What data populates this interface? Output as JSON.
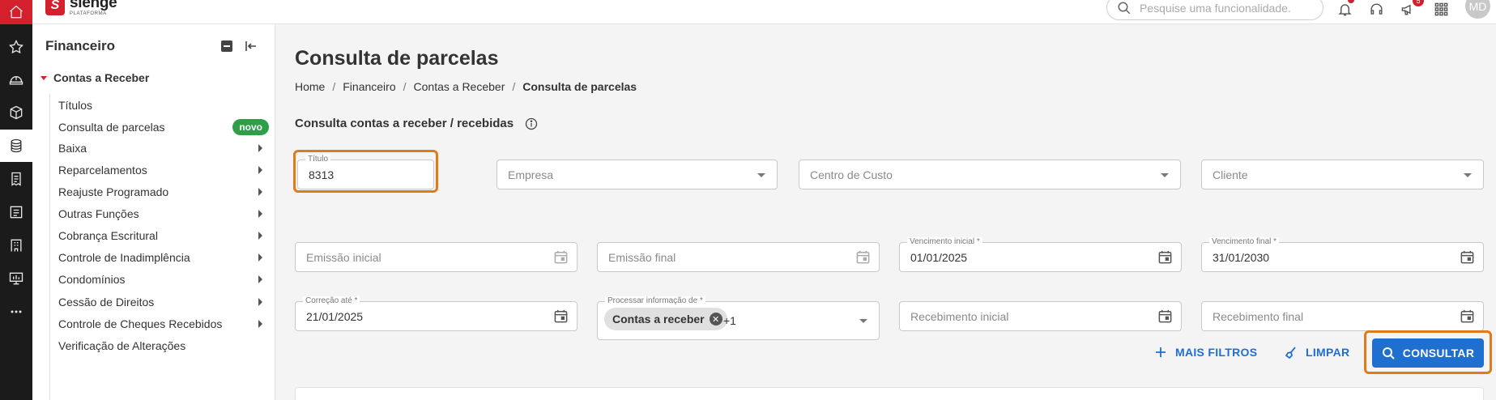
{
  "brand": {
    "name": "sienge",
    "subtitle": "PLATAFORMA",
    "mark": "S",
    "color": "#d4202c"
  },
  "topbar": {
    "search_placeholder": "Pesquise uma funcionalidade.",
    "notifications_badge": "5",
    "user_initials": "MD"
  },
  "sidebar": {
    "title": "Financeiro",
    "group": "Contas a Receber",
    "items": [
      {
        "label": "Títulos"
      },
      {
        "label": "Consulta de parcelas",
        "tag": "novo"
      },
      {
        "label": "Baixa"
      },
      {
        "label": "Reparcelamentos"
      },
      {
        "label": "Reajuste Programado"
      },
      {
        "label": "Outras Funções"
      },
      {
        "label": "Cobrança Escritural"
      },
      {
        "label": "Controle de Inadimplência"
      },
      {
        "label": "Condomínios"
      },
      {
        "label": "Cessão de Direitos"
      },
      {
        "label": "Controle de Cheques Recebidos"
      },
      {
        "label": "Verificação de Alterações"
      }
    ]
  },
  "main": {
    "title": "Consulta de parcelas",
    "breadcrumb": [
      "Home",
      "Financeiro",
      "Contas a Receber",
      "Consulta de parcelas"
    ],
    "section_title": "Consulta contas a receber / recebidas",
    "fields": {
      "titulo": {
        "label": "Título",
        "value": "8313"
      },
      "empresa": {
        "placeholder": "Empresa"
      },
      "centro_custo": {
        "placeholder": "Centro de Custo"
      },
      "cliente": {
        "placeholder": "Cliente"
      },
      "emissao_inicial": {
        "placeholder": "Emissão inicial"
      },
      "emissao_final": {
        "placeholder": "Emissão final"
      },
      "vencimento_inicial": {
        "label": "Vencimento inicial *",
        "value": "01/01/2025"
      },
      "vencimento_final": {
        "label": "Vencimento final *",
        "value": "31/01/2030"
      },
      "correcao_ate": {
        "label": "Correção até *",
        "value": "21/01/2025"
      },
      "processar": {
        "label": "Processar informação de *",
        "chip": "Contas a receber",
        "extra": "+1"
      },
      "recebimento_inicial": {
        "placeholder": "Recebimento inicial"
      },
      "recebimento_final": {
        "placeholder": "Recebimento final"
      }
    },
    "actions": {
      "more_filters": "MAIS FILTROS",
      "clear": "LIMPAR",
      "submit": "CONSULTAR"
    },
    "highlight_color": "#e07b1c",
    "primary_color": "#1f6fd1"
  }
}
